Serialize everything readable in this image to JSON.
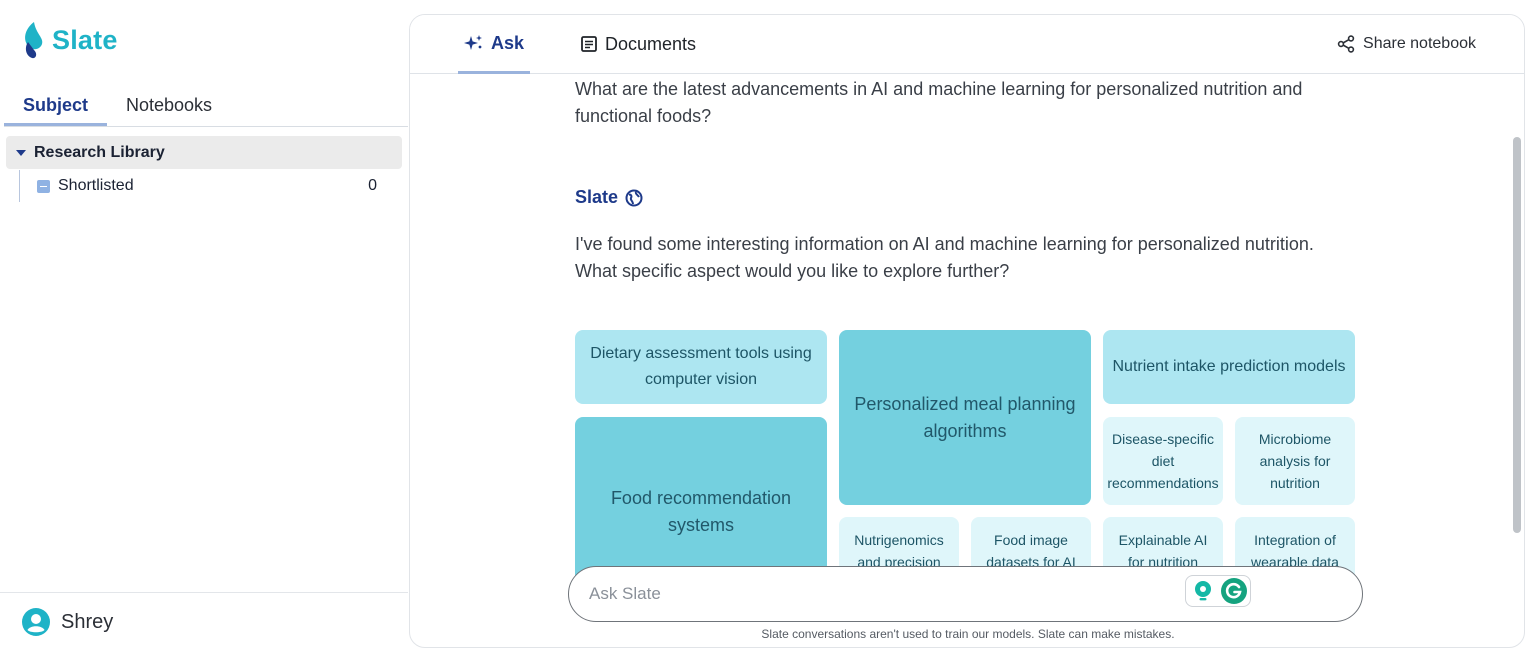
{
  "brand": {
    "name": "Slate",
    "color": "#1fb3c7"
  },
  "sidebar": {
    "tabs": [
      {
        "label": "Subject",
        "active": true
      },
      {
        "label": "Notebooks",
        "active": false
      }
    ],
    "tree": {
      "root_label": "Research Library",
      "children": [
        {
          "label": "Shortlisted",
          "count": "0"
        }
      ]
    },
    "user": {
      "name": "Shrey",
      "icon": "user-avatar-icon"
    }
  },
  "main": {
    "tabs": [
      {
        "label": "Ask",
        "icon": "sparkle-icon",
        "active": true
      },
      {
        "label": "Documents",
        "icon": "document-icon",
        "active": false
      }
    ],
    "share_label": "Share notebook",
    "conversation": {
      "question": "What are the latest advancements in AI and machine learning for personalized nutrition and functional foods?",
      "responder": "Slate",
      "responder_icon": "globe-icon",
      "answer": "I've found some interesting information on AI and machine learning for personalized nutrition. What specific aspect would you like to explore further?"
    },
    "topics": [
      "Dietary assessment tools using computer vision",
      "Food recommendation systems",
      "Personalized meal planning algorithms",
      "Nutrient intake prediction models",
      "Disease-specific diet recommendations",
      "Microbiome analysis for nutrition",
      "Nutrigenomics and precision",
      "Food image datasets for AI",
      "Explainable AI for nutrition",
      "Integration of wearable data"
    ],
    "input": {
      "placeholder": "Ask Slate",
      "value": ""
    },
    "disclaimer": "Slate conversations aren't used to train our models. Slate can make mistakes."
  },
  "colors": {
    "accent": "#1e3a8a",
    "tile_large": "#74d0df",
    "tile_mid": "#ade6f1",
    "tile_small": "#dff6fa"
  }
}
